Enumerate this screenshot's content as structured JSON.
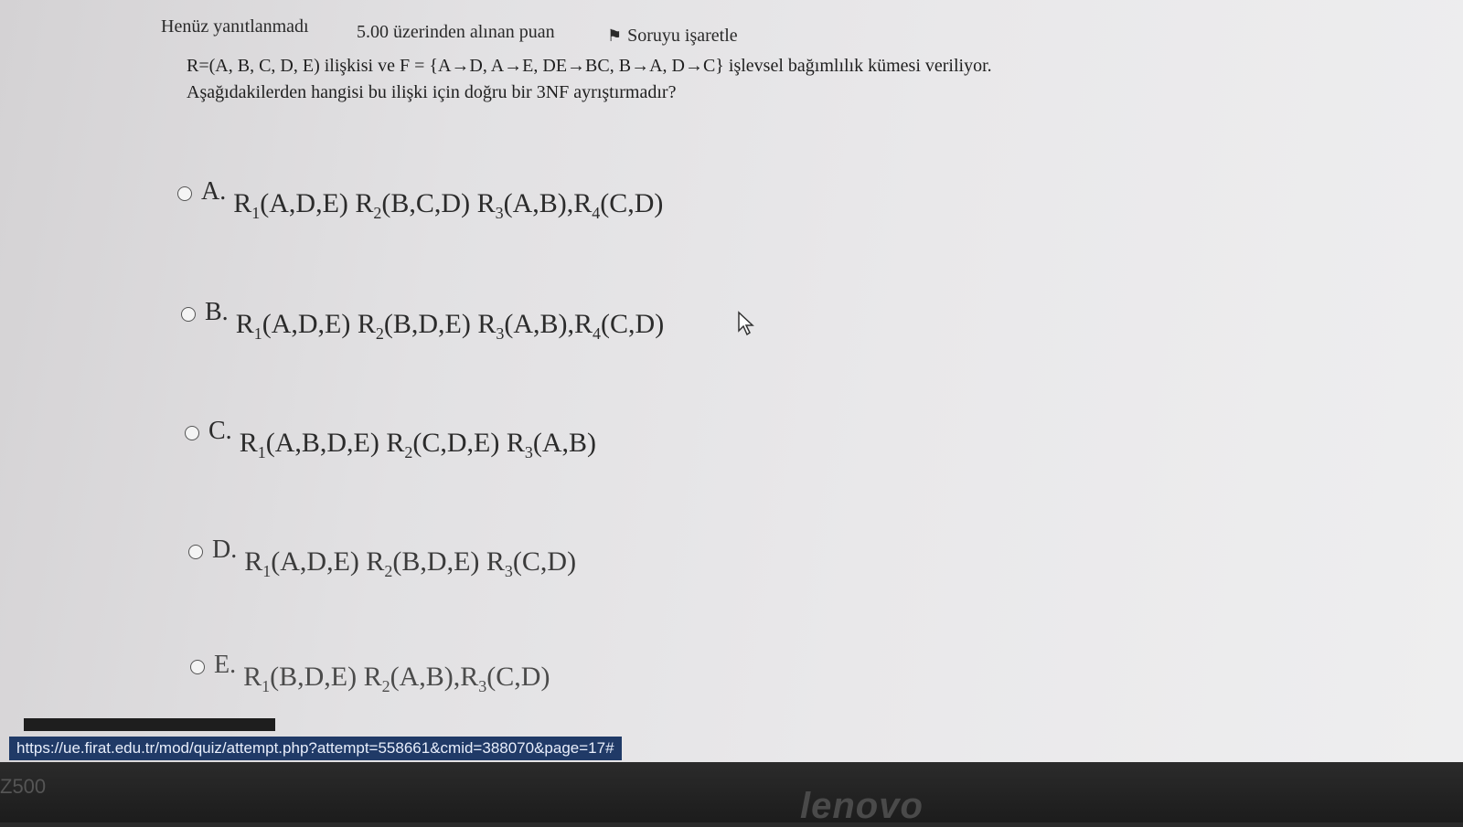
{
  "header": {
    "status": "Henüz yanıtlanmadı",
    "grade": "5.00 üzerinden alınan puan",
    "flag_label": "Soruyu işaretle"
  },
  "question": {
    "text": "R=(A, B, C, D, E) ilişkisi ve F = {A→D, A→E, DE→BC, B→A, D→C} işlevsel bağımlılık kümesi veriliyor. Aşağıdakilerden hangisi bu ilişki için doğru bir 3NF ayrıştırmadır?"
  },
  "options": [
    {
      "letter": "A.",
      "relations": [
        {
          "name": "R",
          "sub": "1",
          "attrs": "(A,D,E) "
        },
        {
          "name": "R",
          "sub": "2",
          "attrs": "(B,C,D) "
        },
        {
          "name": "R",
          "sub": "3",
          "attrs": "(A,B),"
        },
        {
          "name": "R",
          "sub": "4",
          "attrs": "(C,D)"
        }
      ]
    },
    {
      "letter": "B.",
      "relations": [
        {
          "name": "R",
          "sub": "1",
          "attrs": "(A,D,E) "
        },
        {
          "name": "R",
          "sub": "2",
          "attrs": "(B,D,E) "
        },
        {
          "name": "R",
          "sub": "3",
          "attrs": "(A,B),"
        },
        {
          "name": "R",
          "sub": "4",
          "attrs": "(C,D)"
        }
      ]
    },
    {
      "letter": "C.",
      "relations": [
        {
          "name": "R",
          "sub": "1",
          "attrs": "(A,B,D,E) "
        },
        {
          "name": "R",
          "sub": "2",
          "attrs": "(C,D,E) "
        },
        {
          "name": "R",
          "sub": "3",
          "attrs": "(A,B)"
        }
      ]
    },
    {
      "letter": "D.",
      "relations": [
        {
          "name": "R",
          "sub": "1",
          "attrs": "(A,D,E) "
        },
        {
          "name": "R",
          "sub": "2",
          "attrs": "(B,D,E) "
        },
        {
          "name": "R",
          "sub": "3",
          "attrs": "(C,D)"
        }
      ]
    },
    {
      "letter": "E.",
      "relations": [
        {
          "name": "R",
          "sub": "1",
          "attrs": "(B,D,E) "
        },
        {
          "name": "R",
          "sub": "2",
          "attrs": "(A,B),"
        },
        {
          "name": "R",
          "sub": "3",
          "attrs": "(C,D)"
        }
      ]
    }
  ],
  "status_url": "https://ue.firat.edu.tr/mod/quiz/attempt.php?attempt=558661&cmid=388070&page=17#",
  "bezel": {
    "model": "Z500",
    "brand": "lenovo"
  },
  "colors": {
    "statusbar": "#203a67",
    "page_bg": "#e6e5e7",
    "text": "#1f1f1f"
  }
}
